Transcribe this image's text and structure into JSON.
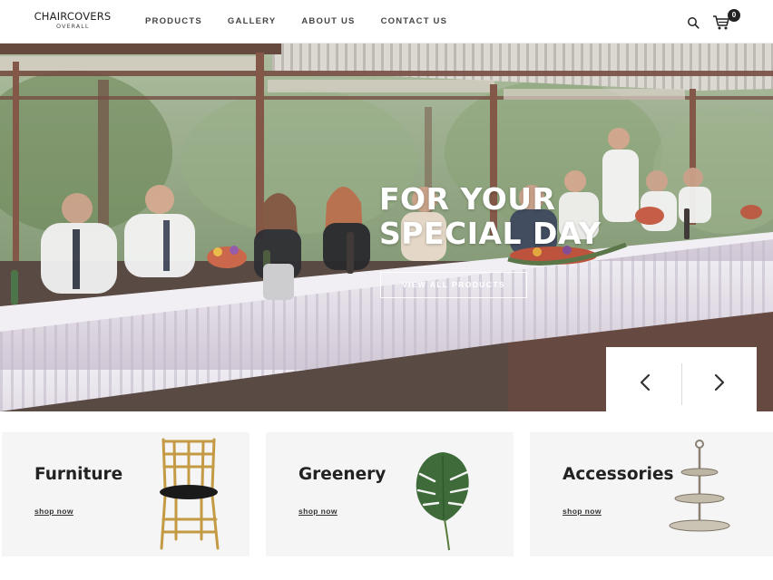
{
  "header": {
    "logo_main": "CHAIRCOVERS",
    "logo_sub": "OVERALL",
    "nav": [
      {
        "label": "PRODUCTS"
      },
      {
        "label": "GALLERY"
      },
      {
        "label": "ABOUT US"
      },
      {
        "label": "CONTACT US"
      }
    ],
    "cart_count": "0"
  },
  "hero": {
    "title_line1": "FOR YOUR",
    "title_line2": "SPECIAL DAY",
    "button_label": "VIEW ALL PRODUCTS"
  },
  "categories": [
    {
      "title": "Furniture",
      "link": "shop now"
    },
    {
      "title": "Greenery",
      "link": "shop now"
    },
    {
      "title": "Accessories",
      "link": "shop now"
    }
  ],
  "colors": {
    "text": "#222222",
    "card_bg": "#f5f5f5",
    "tablecloth": "#ebe6ef"
  },
  "icons": [
    "search-icon",
    "cart-icon",
    "chevron-left-icon",
    "chevron-right-icon"
  ]
}
